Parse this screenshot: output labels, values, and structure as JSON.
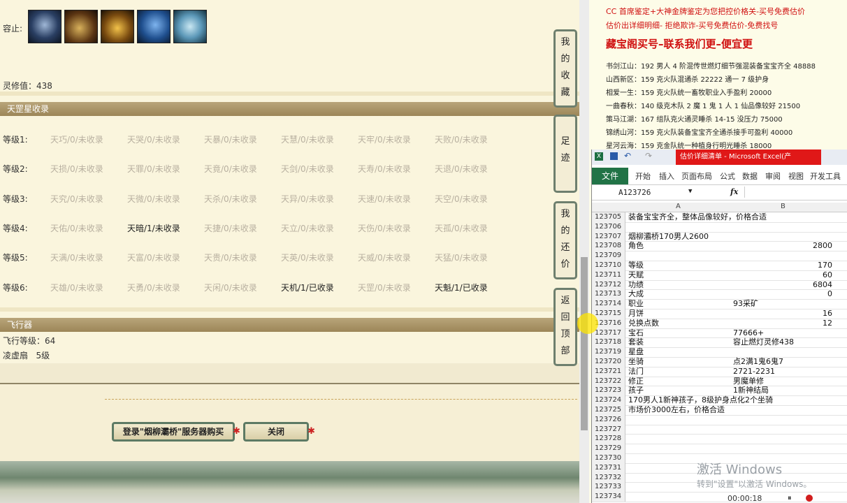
{
  "game": {
    "rongzhi_label": "容止:",
    "lingxiu_label": "灵修值：438",
    "section_star": "天罡星收录",
    "levels": [
      {
        "label": "等级1:",
        "stars": [
          "天巧/0/未收录",
          "天哭/0/未收录",
          "天暴/0/未收录",
          "天慧/0/未收录",
          "天牢/0/未收录",
          "天败/0/未收录"
        ],
        "dark": [
          false,
          false,
          false,
          false,
          false,
          false
        ]
      },
      {
        "label": "等级2:",
        "stars": [
          "天损/0/未收录",
          "天罪/0/未收录",
          "天竟/0/未收录",
          "天剑/0/未收录",
          "天寿/0/未收录",
          "天退/0/未收录"
        ],
        "dark": [
          false,
          false,
          false,
          false,
          false,
          false
        ]
      },
      {
        "label": "等级3:",
        "stars": [
          "天究/0/未收录",
          "天微/0/未收录",
          "天杀/0/未收录",
          "天异/0/未收录",
          "天速/0/未收录",
          "天空/0/未收录"
        ],
        "dark": [
          false,
          false,
          false,
          false,
          false,
          false
        ]
      },
      {
        "label": "等级4:",
        "stars": [
          "天佑/0/未收录",
          "天暗/1/未收录",
          "天捷/0/未收录",
          "天立/0/未收录",
          "天伤/0/未收录",
          "天孤/0/未收录"
        ],
        "dark": [
          false,
          true,
          false,
          false,
          false,
          false
        ]
      },
      {
        "label": "等级5:",
        "stars": [
          "天满/0/未收录",
          "天富/0/未收录",
          "天贵/0/未收录",
          "天英/0/未收录",
          "天威/0/未收录",
          "天猛/0/未收录"
        ],
        "dark": [
          false,
          false,
          false,
          false,
          false,
          false
        ]
      },
      {
        "label": "等级6:",
        "stars": [
          "天雄/0/未收录",
          "天勇/0/未收录",
          "天闲/0/未收录",
          "天机/1/已收录",
          "天罡/0/未收录",
          "天魁/1/已收录"
        ],
        "dark": [
          false,
          false,
          false,
          true,
          false,
          true
        ]
      }
    ],
    "section_fly": "飞行器",
    "fly_level": "飞行等级：64",
    "fly_name": "凌虚扇   5级",
    "buy_button": "登录\"烟柳灞桥\"服务器购买",
    "close_button": "关闭",
    "side_buttons": [
      "我的收藏",
      "足迹",
      "我的还价",
      "返回顶部"
    ]
  },
  "ads": {
    "line1": "CC 首席鉴定+大神金牌鉴定为您把控价格关-买号免费估价",
    "line2": "估价出详细明细- 拒绝欺诈-买号免费估价-免费找号",
    "headline": "藏宝阁买号–联系我们更–便宜更",
    "listings": [
      "书剑江山：192 男人 4 阶混传世燃灯细节强混装备宝宝齐全 48888",
      "山西新区：159 克火队混通杀 22222 通一 7 级护身",
      "相爱一生：159 克火队统一畜牧职业入手盈利 20000",
      "一曲春秋：140 级克木队 2 魔 1 鬼 1 人 1 仙品像较好 21500",
      "策马江湖：167 组队克火通灵睡杀 14-15 没压力 75000",
      "锦绣山河：159 克火队装备宝宝齐全通杀接手可盈利 40000",
      "星河云海：159 克金队统一种植身行明光睡杀 18000"
    ]
  },
  "excel": {
    "window_title": "估价详细清单 - Microsoft Excel(产",
    "tabs": [
      "文件",
      "开始",
      "插入",
      "页面布局",
      "公式",
      "数据",
      "审阅",
      "视图",
      "开发工具"
    ],
    "name_box": "A123726",
    "fx": "fx",
    "col_a": "A",
    "col_b": "B",
    "rows": [
      {
        "n": "123705",
        "a": "装备宝宝齐全，整体品像较好，价格合适",
        "b": "",
        "num": false
      },
      {
        "n": "123706",
        "a": "",
        "b": "",
        "num": false
      },
      {
        "n": "123707",
        "a": "烟柳灞桥170男人2600",
        "b": "",
        "num": false
      },
      {
        "n": "123708",
        "a": "角色",
        "b": "2800",
        "num": true
      },
      {
        "n": "123709",
        "a": "",
        "b": "",
        "num": false
      },
      {
        "n": "123710",
        "a": "等级",
        "b": "170",
        "num": true
      },
      {
        "n": "123711",
        "a": "天赋",
        "b": "60",
        "num": true
      },
      {
        "n": "123712",
        "a": "功绩",
        "b": "6804",
        "num": true
      },
      {
        "n": "123713",
        "a": "大成",
        "b": "0",
        "num": true
      },
      {
        "n": "123714",
        "a": "职业",
        "b": "93采矿",
        "num": false
      },
      {
        "n": "123715",
        "a": "月饼",
        "b": "16",
        "num": true
      },
      {
        "n": "123716",
        "a": "兑换点数",
        "b": "12",
        "num": true
      },
      {
        "n": "123717",
        "a": "宝石",
        "b": "77666+",
        "num": false
      },
      {
        "n": "123718",
        "a": "套装",
        "b": "容止燃灯灵修438",
        "num": false
      },
      {
        "n": "123719",
        "a": "星盘",
        "b": "",
        "num": false
      },
      {
        "n": "123720",
        "a": "坐骑",
        "b": "点2满1鬼6鬼7",
        "num": false
      },
      {
        "n": "123721",
        "a": "法门",
        "b": "2721-2231",
        "num": false
      },
      {
        "n": "123722",
        "a": "修正",
        "b": "男魔单修",
        "num": false
      },
      {
        "n": "123723",
        "a": "孩子",
        "b": "1新神结局",
        "num": false
      },
      {
        "n": "123724",
        "a": "170男人1新神孩子，8级护身点化2个坐骑",
        "b": "",
        "num": false
      },
      {
        "n": "123725",
        "a": "市场价3000左右，价格合适",
        "b": "",
        "num": false
      },
      {
        "n": "123726",
        "a": "",
        "b": "",
        "num": false
      },
      {
        "n": "123727",
        "a": "",
        "b": "",
        "num": false
      },
      {
        "n": "123728",
        "a": "",
        "b": "",
        "num": false
      },
      {
        "n": "123729",
        "a": "",
        "b": "",
        "num": false
      },
      {
        "n": "123730",
        "a": "",
        "b": "",
        "num": false
      },
      {
        "n": "123731",
        "a": "",
        "b": "",
        "num": false
      },
      {
        "n": "123732",
        "a": "",
        "b": "",
        "num": false
      },
      {
        "n": "123733",
        "a": "",
        "b": "",
        "num": false
      },
      {
        "n": "123734",
        "a": "",
        "b": "",
        "num": false
      }
    ],
    "watermark_title": "激活 Windows",
    "watermark_sub": "转到\"设置\"以激活 Windows。",
    "timer": "00:00:18"
  }
}
